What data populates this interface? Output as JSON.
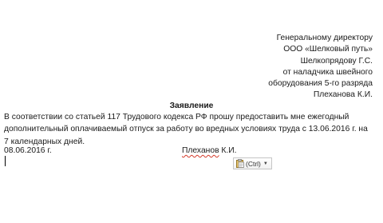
{
  "addressee": {
    "lines": [
      "Генеральному директору",
      "ООО «Шелковый путь»",
      "Шелкопрядову Г.С.",
      "от наладчика швейного",
      "оборудования 5-го разряда",
      "Плеханова К.И."
    ]
  },
  "document": {
    "title": "Заявление",
    "body_lines": [
      "В соответствии со статьей 117 Трудового кодекса РФ прошу предоставить мне ежегодный",
      "дополнительный оплачиваемый отпуск за работу во вредных условиях труда с 13.06.2016 г. на",
      "7 календарных дней."
    ],
    "date": "08.06.2016 г.",
    "signature_surname": "Плеханов",
    "signature_initials": " К.И."
  },
  "paste_options": {
    "label": "(Ctrl)",
    "icon": "clipboard-icon"
  }
}
